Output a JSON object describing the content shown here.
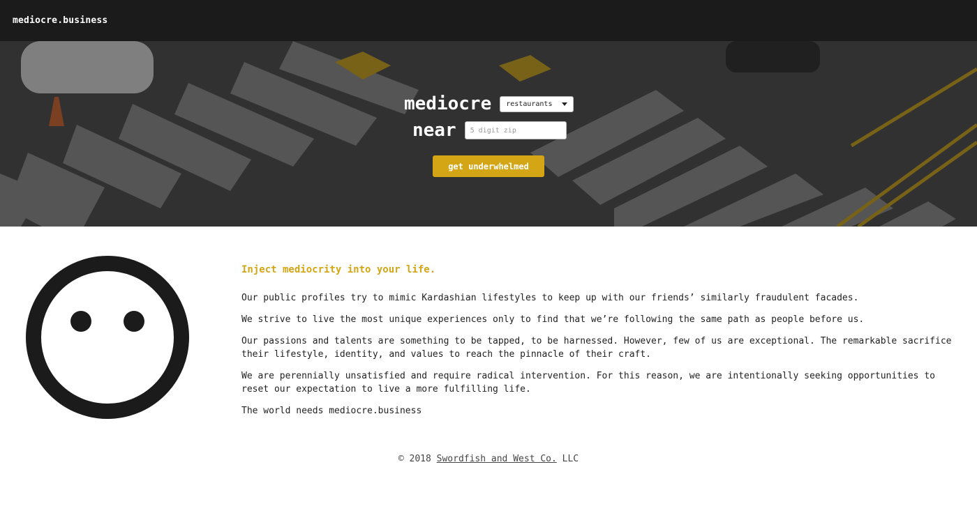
{
  "brand": "mediocre.business",
  "hero": {
    "word1": "mediocre",
    "word2": "near",
    "category_select": {
      "value": "restaurants"
    },
    "zip_input": {
      "placeholder": "5 digit zip",
      "value": ""
    },
    "cta_label": "get underwhelmed"
  },
  "content": {
    "headline": "Inject mediocrity into your life.",
    "paragraphs": [
      "Our public profiles try to mimic Kardashian lifestyles to keep up with our friends’ similarly fraudulent facades.",
      "We strive to live the most unique experiences only to find that we’re following the same path as people before us.",
      "Our passions and talents are something to be tapped, to be harnessed. However, few of us are exceptional. The remarkable sacrifice their lifestyle, identity, and values to reach the pinnacle of their craft.",
      "We are perennially unsatisfied and require radical intervention. For this reason, we are intentionally seeking opportunities to reset our expectation to live a more fulfilling life.",
      "The world needs mediocre.business"
    ]
  },
  "footer": {
    "prefix": "© 2018",
    "link_text": "Swordfish and West Co.",
    "suffix": "LLC"
  },
  "colors": {
    "accent": "#d4a514",
    "topbar": "#1c1b1b",
    "text": "#222222"
  },
  "icons": {
    "logo": "neutral-face-icon",
    "dropdown": "caret-down-icon"
  }
}
